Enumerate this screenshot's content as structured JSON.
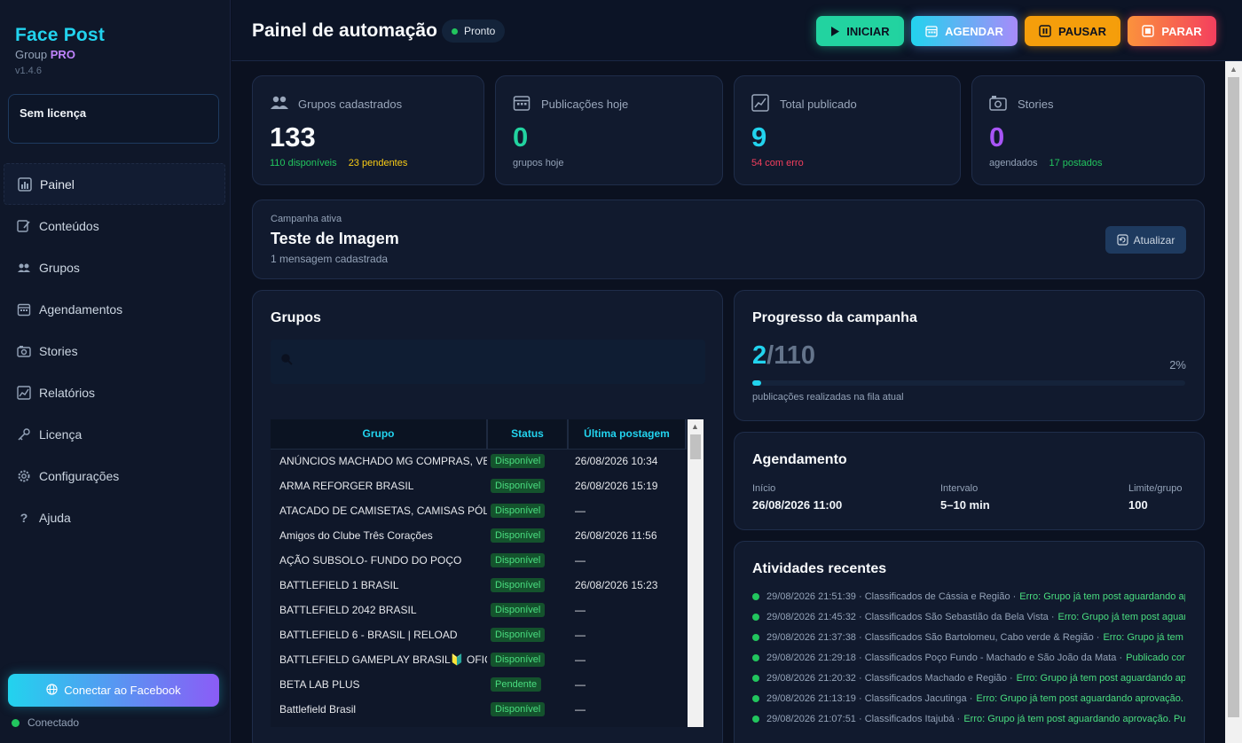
{
  "brand": {
    "title": "Face Post",
    "group": "Group",
    "pro": "PRO",
    "version": "v1.4.6"
  },
  "license_box": "Sem licença",
  "nav": [
    {
      "label": "Painel",
      "icon": "chart-bar-icon"
    },
    {
      "label": "Conteúdos",
      "icon": "edit-icon"
    },
    {
      "label": "Grupos",
      "icon": "users-icon"
    },
    {
      "label": "Agendamentos",
      "icon": "calendar-icon"
    },
    {
      "label": "Stories",
      "icon": "camera-icon"
    },
    {
      "label": "Relatórios",
      "icon": "chart-line-icon"
    },
    {
      "label": "Licença",
      "icon": "key-icon"
    },
    {
      "label": "Configurações",
      "icon": "gear-icon"
    },
    {
      "label": "Ajuda",
      "icon": "help-icon"
    }
  ],
  "facebook_button": "Conectar ao Facebook",
  "connection_status": "Conectado",
  "header": {
    "title": "Painel de automação",
    "status": "Pronto",
    "buttons": {
      "start": "INICIAR",
      "schedule": "AGENDAR",
      "pause": "PAUSAR",
      "stop": "PARAR"
    }
  },
  "stats": {
    "groups": {
      "label": "Grupos cadastrados",
      "value": "133",
      "available": "110 disponíveis",
      "pending": "23 pendentes"
    },
    "today": {
      "label": "Publicações hoje",
      "value": "0",
      "sub": "grupos hoje"
    },
    "total": {
      "label": "Total publicado",
      "value": "9",
      "sub": "54 com erro"
    },
    "stories": {
      "label": "Stories",
      "value": "0",
      "scheduled": "agendados",
      "posted": "17 postados"
    }
  },
  "campaign": {
    "label": "Campanha ativa",
    "name": "Teste de Imagem",
    "sub": "1 mensagem cadastrada",
    "refresh": "Atualizar"
  },
  "groups_panel": {
    "title": "Grupos",
    "search_value": "",
    "columns": [
      "Grupo",
      "Status",
      "Última postagem"
    ],
    "rows": [
      {
        "name": "ANÚNCIOS MACHADO MG COMPRAS, VENDAS",
        "status": "Disponível",
        "last": "26/08/2026 10:34"
      },
      {
        "name": "ARMA REFORGER BRASIL",
        "status": "Disponível",
        "last": "26/08/2026 15:19"
      },
      {
        "name": "ATACADO DE CAMISETAS, CAMISAS PÓLOS",
        "status": "Disponível",
        "last": "—"
      },
      {
        "name": "Amigos do Clube Três Corações",
        "status": "Disponível",
        "last": "26/08/2026 11:56"
      },
      {
        "name": "AÇÃO SUBSOLO- FUNDO DO POÇO",
        "status": "Disponível",
        "last": "—"
      },
      {
        "name": "BATTLEFIELD 1 BRASIL",
        "status": "Disponível",
        "last": "26/08/2026 15:23"
      },
      {
        "name": "BATTLEFIELD 2042  BRASIL",
        "status": "Disponível",
        "last": "—"
      },
      {
        "name": "BATTLEFIELD 6 - BRASIL  |  RELOAD",
        "status": "Disponível",
        "last": "—"
      },
      {
        "name": "BATTLEFIELD GAMEPLAY BRASIL🔰 OFICIAL",
        "status": "Disponível",
        "last": "—"
      },
      {
        "name": "BETA LAB PLUS",
        "status": "Pendente",
        "last": "—"
      },
      {
        "name": "Battlefield Brasil",
        "status": "Disponível",
        "last": "—"
      }
    ]
  },
  "progress": {
    "title": "Progresso da campanha",
    "current": "2",
    "total": "/110",
    "percent_label": "2%",
    "fraction": 0.02,
    "sub": "publicações realizadas na fila atual"
  },
  "schedule": {
    "title": "Agendamento",
    "start_label": "Início",
    "start_value": "26/08/2026 11:00",
    "interval_label": "Intervalo",
    "interval_value": "5–10 min",
    "limit_label": "Limite/grupo",
    "limit_value": "100"
  },
  "activities": {
    "title": "Atividades recentes",
    "items": [
      {
        "meta": "29/08/2026 21:51:39 · Classificados de Cássia e Região ·",
        "msg": "Erro: Grupo já tem post aguardando aprovação."
      },
      {
        "meta": "29/08/2026 21:45:32 · Classificados São Sebastião da Bela Vista ·",
        "msg": "Erro: Grupo já tem post aguardando aprovação."
      },
      {
        "meta": "29/08/2026 21:37:38 · Classificados São Bartolomeu, Cabo verde & Região ·",
        "msg": "Erro: Grupo já tem post aguardando aprovação."
      },
      {
        "meta": "29/08/2026 21:29:18 · Classificados Poço Fundo - Machado e São João da Mata ·",
        "msg": "Publicado com sucesso"
      },
      {
        "meta": "29/08/2026 21:20:32 · Classificados Machado e Região ·",
        "msg": "Erro: Grupo já tem post aguardando aprovação."
      },
      {
        "meta": "29/08/2026 21:13:19 · Classificados Jacutinga ·",
        "msg": "Erro: Grupo já tem post aguardando aprovação. Pulando grupo."
      },
      {
        "meta": "29/08/2026 21:07:51 · Classificados Itajubá ·",
        "msg": "Erro: Grupo já tem post aguardando aprovação. Pulando grupo."
      }
    ]
  },
  "colors": {
    "accent": "#22d3ee",
    "success": "#22c55e",
    "warning": "#f59e0b",
    "danger": "#f43f5e",
    "purple": "#a855f7"
  }
}
